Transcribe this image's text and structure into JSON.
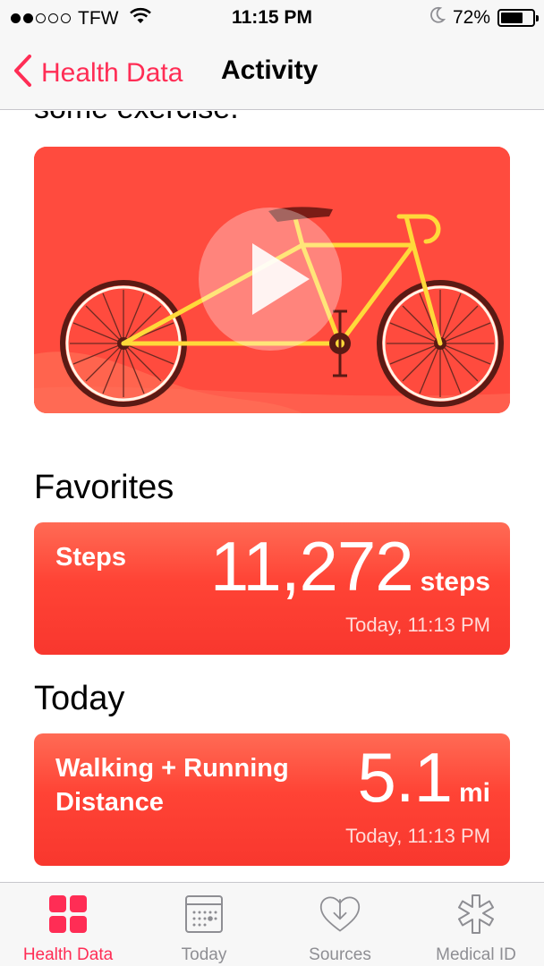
{
  "status_bar": {
    "carrier": "TFW",
    "time": "11:15 PM",
    "battery_percent": "72%",
    "battery_level": 0.72,
    "signal_bars_filled": 2,
    "signal_bars_total": 5
  },
  "nav": {
    "back_label": "Health Data",
    "title": "Activity",
    "accent_color": "#ff2d55"
  },
  "intro": {
    "text": "some exercise."
  },
  "video": {
    "icon": "play-icon"
  },
  "favorites": {
    "heading": "Favorites",
    "card": {
      "label": "Steps",
      "value": "11,272",
      "unit": "steps",
      "time": "Today, 11:13 PM"
    }
  },
  "today": {
    "heading": "Today",
    "card": {
      "label_line1": "Walking + Running",
      "label_line2": "Distance",
      "value": "5.1",
      "unit": "mi",
      "time": "Today, 11:13 PM"
    }
  },
  "tabs": [
    {
      "label": "Health Data",
      "icon": "grid-icon",
      "active": true
    },
    {
      "label": "Today",
      "icon": "calendar-icon",
      "active": false
    },
    {
      "label": "Sources",
      "icon": "sources-heart-icon",
      "active": false
    },
    {
      "label": "Medical ID",
      "icon": "medical-star-icon",
      "active": false
    }
  ],
  "colors": {
    "accent": "#ff2d55",
    "card_red": "#ff4335",
    "inactive_tab": "#8e8e93"
  }
}
